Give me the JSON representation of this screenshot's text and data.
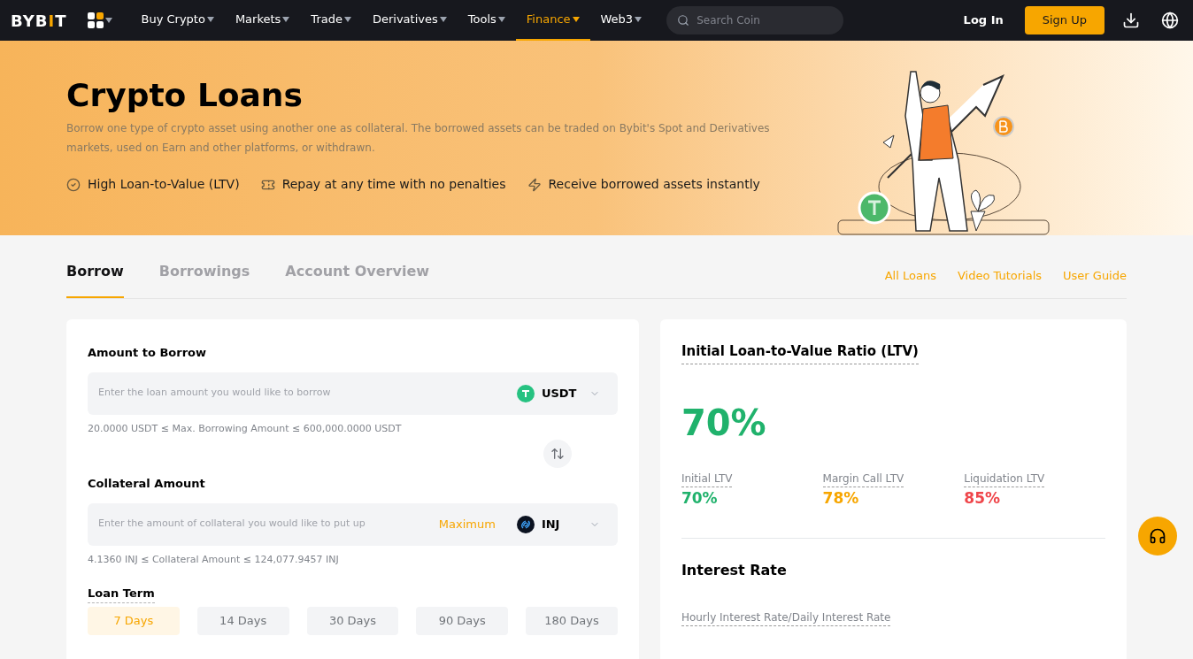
{
  "nav": {
    "logo": [
      {
        "text": "BYB",
        "accent": false
      },
      {
        "text": "I",
        "accent": true
      },
      {
        "text": "T",
        "accent": false
      }
    ],
    "items": [
      {
        "label": "Buy Crypto",
        "selected": false
      },
      {
        "label": "Markets",
        "selected": false
      },
      {
        "label": "Trade",
        "selected": false
      },
      {
        "label": "Derivatives",
        "selected": false
      },
      {
        "label": "Tools",
        "selected": false
      },
      {
        "label": "Finance",
        "selected": true
      },
      {
        "label": "Web3",
        "selected": false
      }
    ],
    "search": {
      "placeholder": "Search Coin"
    },
    "login": "Log In",
    "signup": "Sign Up"
  },
  "hero": {
    "title": "Crypto Loans",
    "description": "Borrow one type of crypto asset using another one as collateral. The borrowed assets can be traded on Bybit's Spot and Derivatives markets, used on Earn and other platforms, or withdrawn.",
    "features": [
      {
        "kind": "check",
        "label": "High Loan-to-Value (LTV)"
      },
      {
        "kind": "ticket",
        "label": "Repay at any time with no penalties"
      },
      {
        "kind": "bolt",
        "label": "Receive borrowed assets instantly"
      }
    ]
  },
  "tabs": [
    {
      "label": "Borrow",
      "selected": true
    },
    {
      "label": "Borrowings",
      "selected": false
    },
    {
      "label": "Account Overview",
      "selected": false
    }
  ],
  "links": [
    "All Loans",
    "Video Tutorials",
    "User Guide"
  ],
  "borrow": {
    "amount_label": "Amount to Borrow",
    "amount_placeholder": "Enter the loan amount you would like to borrow",
    "amount_coin": {
      "symbol": "USDT",
      "kind": "tether"
    },
    "amount_range": "20.0000 USDT ≤ Max. Borrowing Amount ≤ 600,000.0000 USDT",
    "collateral_label": "Collateral Amount",
    "collateral_placeholder": "Enter the amount of collateral you would like to put up",
    "maximum": "Maximum",
    "collateral_coin": {
      "symbol": "INJ",
      "kind": "injective"
    },
    "collateral_range": "4.1360 INJ ≤ Collateral Amount ≤ 124,077.9457 INJ",
    "term_label": "Loan Term",
    "terms": [
      {
        "label": "7 Days",
        "selected": true
      },
      {
        "label": "14 Days",
        "selected": false
      },
      {
        "label": "30 Days",
        "selected": false
      },
      {
        "label": "90 Days",
        "selected": false
      },
      {
        "label": "180 Days",
        "selected": false
      }
    ]
  },
  "ltv": {
    "title": "Initial Loan-to-Value Ratio (LTV)",
    "value": "70%",
    "metrics": [
      {
        "label": "Initial LTV",
        "value": "70%",
        "color": "#20b26c"
      },
      {
        "label": "Margin Call LTV",
        "value": "78%",
        "color": "#f7a600"
      },
      {
        "label": "Liquidation LTV",
        "value": "85%",
        "color": "#ef454a"
      }
    ],
    "interest_title": "Interest Rate",
    "interest_label": "Hourly Interest Rate/Daily Interest Rate"
  }
}
